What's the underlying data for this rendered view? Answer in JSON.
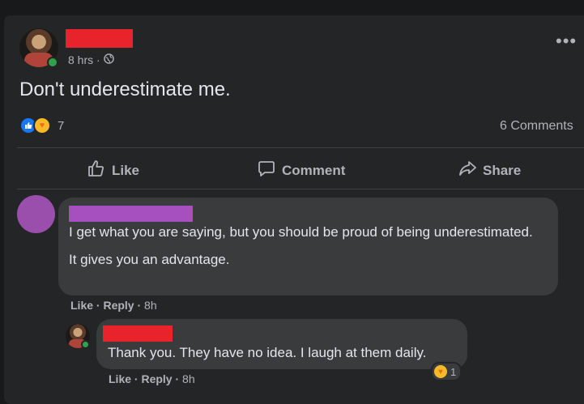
{
  "post": {
    "time": "8 hrs ·",
    "privacy_icon": "globe-icon",
    "text": "Don't underestimate me.",
    "reaction_count": "7",
    "comments_count": "6 Comments",
    "more_icon": "more-dots-icon"
  },
  "actions": {
    "like": "Like",
    "comment": "Comment",
    "share": "Share"
  },
  "comments": [
    {
      "lines": [
        "I get what you are saying, but you should be proud of being underestimated.",
        "It gives you an advantage."
      ],
      "like": "Like",
      "reply": "Reply",
      "time": "8h",
      "avatar_color": "#9b4fad"
    }
  ],
  "reply": {
    "text": "Thank you. They have no idea. I laugh at them daily.",
    "like": "Like",
    "reply": "Reply",
    "time": "8h",
    "reaction_count": "1"
  },
  "colors": {
    "background": "#18191a",
    "card": "#242526",
    "bubble": "#3a3b3c",
    "like_blue": "#1877f2",
    "redaction_red": "#e8232c",
    "redaction_purple": "#a64fbf"
  }
}
